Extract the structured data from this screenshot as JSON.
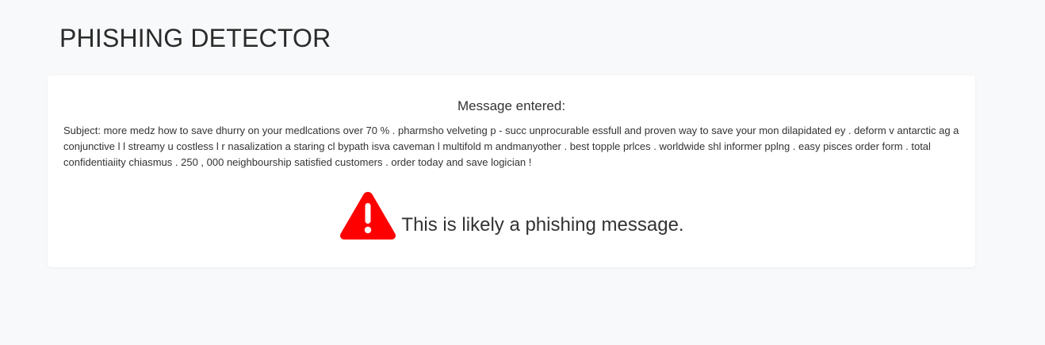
{
  "header": {
    "title": "PHISHING DETECTOR"
  },
  "card": {
    "heading": "Message entered:",
    "message": "Subject: more medz how to save dhurry on your medlcations over 70 % . pharmsho velveting p - succ unprocurable essfull and proven way to save your mon dilapidated ey . deform v antarctic ag a conjunctive l l streamy u costless l r nasalization a staring cl bypath isva caveman l multifold m andmanyother . best topple prlces . worldwide shl informer pplng . easy pisces order form . total confidentiaiity chiasmus . 250 , 000 neighbourship satisfied customers . order today and save logician !",
    "verdict": {
      "icon": "warning-triangle-icon",
      "icon_color": "#ff0000",
      "text": "This is likely a phishing message."
    }
  }
}
